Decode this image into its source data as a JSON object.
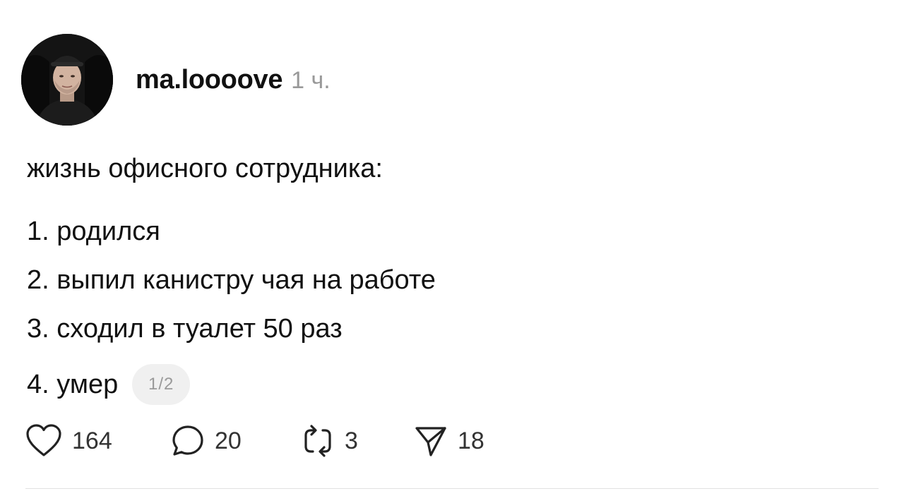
{
  "post": {
    "author": {
      "username": "ma.loooove",
      "avatar_icon": "user-photo-avatar"
    },
    "timestamp": "1 ч.",
    "title": "жизнь офисного сотрудника:",
    "items": [
      "1. родился",
      "2. выпил канистру чая на работе",
      "3. сходил в туалет 50 раз",
      "4. умер"
    ],
    "page_indicator": "1/2",
    "actions": {
      "likes": {
        "icon": "heart-icon",
        "count": "164"
      },
      "comments": {
        "icon": "comment-bubble-icon",
        "count": "20"
      },
      "reposts": {
        "icon": "repost-icon",
        "count": "3"
      },
      "shares": {
        "icon": "send-icon",
        "count": "18"
      }
    }
  },
  "colors": {
    "text": "#111111",
    "muted": "#999999",
    "badge_bg": "#f0f0f0",
    "divider": "#e2e2e2"
  }
}
